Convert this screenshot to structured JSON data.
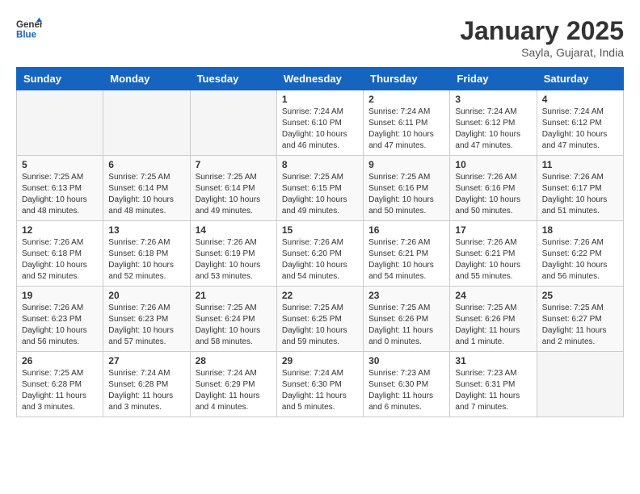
{
  "header": {
    "logo_general": "General",
    "logo_blue": "Blue",
    "month_title": "January 2025",
    "location": "Sayla, Gujarat, India"
  },
  "days_of_week": [
    "Sunday",
    "Monday",
    "Tuesday",
    "Wednesday",
    "Thursday",
    "Friday",
    "Saturday"
  ],
  "weeks": [
    [
      {
        "day": "",
        "info": ""
      },
      {
        "day": "",
        "info": ""
      },
      {
        "day": "",
        "info": ""
      },
      {
        "day": "1",
        "info": "Sunrise: 7:24 AM\nSunset: 6:10 PM\nDaylight: 10 hours\nand 46 minutes."
      },
      {
        "day": "2",
        "info": "Sunrise: 7:24 AM\nSunset: 6:11 PM\nDaylight: 10 hours\nand 47 minutes."
      },
      {
        "day": "3",
        "info": "Sunrise: 7:24 AM\nSunset: 6:12 PM\nDaylight: 10 hours\nand 47 minutes."
      },
      {
        "day": "4",
        "info": "Sunrise: 7:24 AM\nSunset: 6:12 PM\nDaylight: 10 hours\nand 47 minutes."
      }
    ],
    [
      {
        "day": "5",
        "info": "Sunrise: 7:25 AM\nSunset: 6:13 PM\nDaylight: 10 hours\nand 48 minutes."
      },
      {
        "day": "6",
        "info": "Sunrise: 7:25 AM\nSunset: 6:14 PM\nDaylight: 10 hours\nand 48 minutes."
      },
      {
        "day": "7",
        "info": "Sunrise: 7:25 AM\nSunset: 6:14 PM\nDaylight: 10 hours\nand 49 minutes."
      },
      {
        "day": "8",
        "info": "Sunrise: 7:25 AM\nSunset: 6:15 PM\nDaylight: 10 hours\nand 49 minutes."
      },
      {
        "day": "9",
        "info": "Sunrise: 7:25 AM\nSunset: 6:16 PM\nDaylight: 10 hours\nand 50 minutes."
      },
      {
        "day": "10",
        "info": "Sunrise: 7:26 AM\nSunset: 6:16 PM\nDaylight: 10 hours\nand 50 minutes."
      },
      {
        "day": "11",
        "info": "Sunrise: 7:26 AM\nSunset: 6:17 PM\nDaylight: 10 hours\nand 51 minutes."
      }
    ],
    [
      {
        "day": "12",
        "info": "Sunrise: 7:26 AM\nSunset: 6:18 PM\nDaylight: 10 hours\nand 52 minutes."
      },
      {
        "day": "13",
        "info": "Sunrise: 7:26 AM\nSunset: 6:18 PM\nDaylight: 10 hours\nand 52 minutes."
      },
      {
        "day": "14",
        "info": "Sunrise: 7:26 AM\nSunset: 6:19 PM\nDaylight: 10 hours\nand 53 minutes."
      },
      {
        "day": "15",
        "info": "Sunrise: 7:26 AM\nSunset: 6:20 PM\nDaylight: 10 hours\nand 54 minutes."
      },
      {
        "day": "16",
        "info": "Sunrise: 7:26 AM\nSunset: 6:21 PM\nDaylight: 10 hours\nand 54 minutes."
      },
      {
        "day": "17",
        "info": "Sunrise: 7:26 AM\nSunset: 6:21 PM\nDaylight: 10 hours\nand 55 minutes."
      },
      {
        "day": "18",
        "info": "Sunrise: 7:26 AM\nSunset: 6:22 PM\nDaylight: 10 hours\nand 56 minutes."
      }
    ],
    [
      {
        "day": "19",
        "info": "Sunrise: 7:26 AM\nSunset: 6:23 PM\nDaylight: 10 hours\nand 56 minutes."
      },
      {
        "day": "20",
        "info": "Sunrise: 7:26 AM\nSunset: 6:23 PM\nDaylight: 10 hours\nand 57 minutes."
      },
      {
        "day": "21",
        "info": "Sunrise: 7:25 AM\nSunset: 6:24 PM\nDaylight: 10 hours\nand 58 minutes."
      },
      {
        "day": "22",
        "info": "Sunrise: 7:25 AM\nSunset: 6:25 PM\nDaylight: 10 hours\nand 59 minutes."
      },
      {
        "day": "23",
        "info": "Sunrise: 7:25 AM\nSunset: 6:26 PM\nDaylight: 11 hours\nand 0 minutes."
      },
      {
        "day": "24",
        "info": "Sunrise: 7:25 AM\nSunset: 6:26 PM\nDaylight: 11 hours\nand 1 minute."
      },
      {
        "day": "25",
        "info": "Sunrise: 7:25 AM\nSunset: 6:27 PM\nDaylight: 11 hours\nand 2 minutes."
      }
    ],
    [
      {
        "day": "26",
        "info": "Sunrise: 7:25 AM\nSunset: 6:28 PM\nDaylight: 11 hours\nand 3 minutes."
      },
      {
        "day": "27",
        "info": "Sunrise: 7:24 AM\nSunset: 6:28 PM\nDaylight: 11 hours\nand 3 minutes."
      },
      {
        "day": "28",
        "info": "Sunrise: 7:24 AM\nSunset: 6:29 PM\nDaylight: 11 hours\nand 4 minutes."
      },
      {
        "day": "29",
        "info": "Sunrise: 7:24 AM\nSunset: 6:30 PM\nDaylight: 11 hours\nand 5 minutes."
      },
      {
        "day": "30",
        "info": "Sunrise: 7:23 AM\nSunset: 6:30 PM\nDaylight: 11 hours\nand 6 minutes."
      },
      {
        "day": "31",
        "info": "Sunrise: 7:23 AM\nSunset: 6:31 PM\nDaylight: 11 hours\nand 7 minutes."
      },
      {
        "day": "",
        "info": ""
      }
    ]
  ]
}
